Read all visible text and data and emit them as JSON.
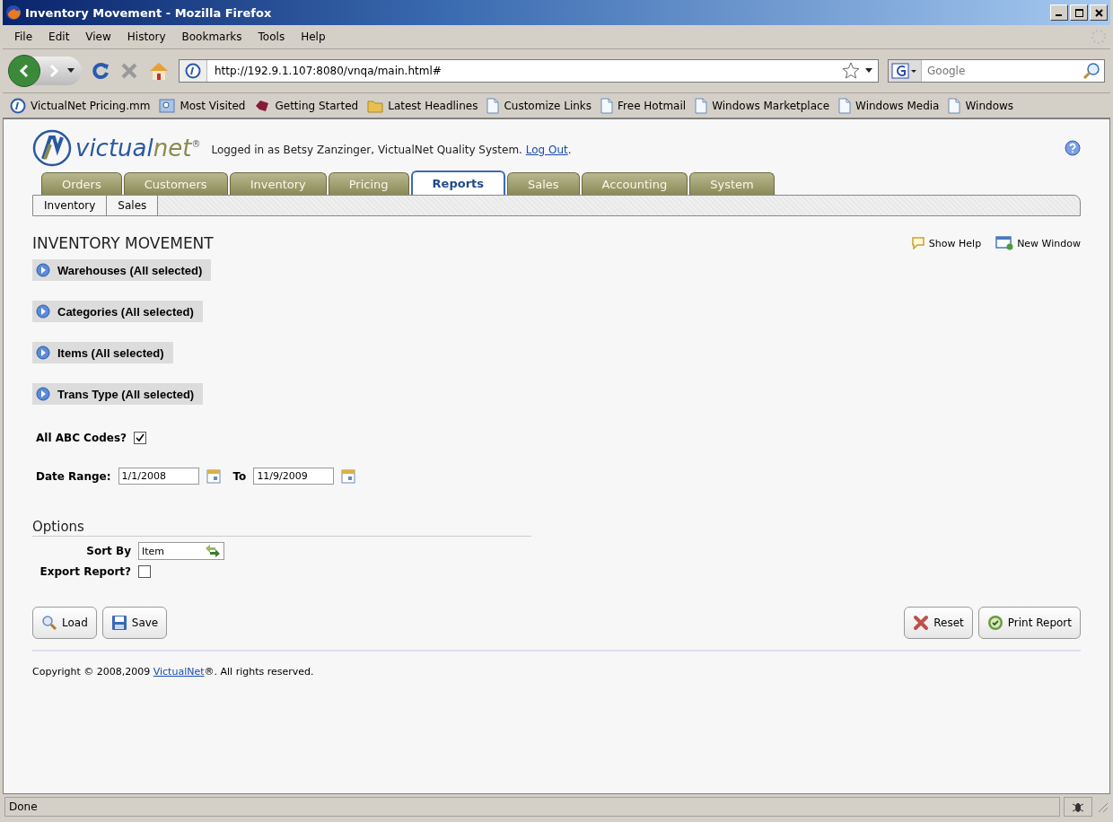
{
  "window": {
    "title": "Inventory Movement - Mozilla Firefox"
  },
  "menu": [
    "File",
    "Edit",
    "View",
    "History",
    "Bookmarks",
    "Tools",
    "Help"
  ],
  "address": {
    "value": "http://192.9.1.107:8080/vnqa/main.html#"
  },
  "search": {
    "placeholder": "Google"
  },
  "bookmarks": [
    {
      "label": "VictualNet Pricing.mm",
      "kind": "site"
    },
    {
      "label": "Most Visited",
      "kind": "folder"
    },
    {
      "label": "Getting Started",
      "kind": "firefox"
    },
    {
      "label": "Latest Headlines",
      "kind": "feed"
    },
    {
      "label": "Customize Links",
      "kind": "page"
    },
    {
      "label": "Free Hotmail",
      "kind": "page"
    },
    {
      "label": "Windows Marketplace",
      "kind": "page"
    },
    {
      "label": "Windows Media",
      "kind": "page"
    },
    {
      "label": "Windows",
      "kind": "page"
    }
  ],
  "header": {
    "logo_first": "victual",
    "logo_second": "net",
    "logo_mark": "®",
    "login_text": "Logged in as Betsy Zanzinger, VictualNet Quality System. ",
    "logout_link": "Log Out",
    "login_end": "."
  },
  "tabs": [
    {
      "label": "Orders",
      "selected": false
    },
    {
      "label": "Customers",
      "selected": false
    },
    {
      "label": "Inventory",
      "selected": false
    },
    {
      "label": "Pricing",
      "selected": false
    },
    {
      "label": "Reports",
      "selected": true
    },
    {
      "label": "Sales",
      "selected": false
    },
    {
      "label": "Accounting",
      "selected": false
    },
    {
      "label": "System",
      "selected": false
    }
  ],
  "subtabs": [
    "Inventory",
    "Sales"
  ],
  "page_title": "INVENTORY MOVEMENT",
  "page_links": [
    {
      "label": "Show Help",
      "kind": "help"
    },
    {
      "label": "New Window",
      "kind": "window"
    }
  ],
  "filters": [
    "Warehouses (All selected)",
    "Categories (All selected)",
    "Items (All selected)",
    "Trans Type (All selected)"
  ],
  "abc": {
    "label": "All ABC Codes?",
    "checked": true
  },
  "date_range": {
    "label": "Date Range:",
    "from": "1/1/2008",
    "to_label": "To",
    "to": "11/9/2009"
  },
  "options": {
    "title": "Options",
    "sort_label": "Sort By",
    "sort_value": "Item",
    "export_label": "Export Report?",
    "export_checked": false
  },
  "left_buttons": [
    {
      "label": "Load",
      "kind": "load"
    },
    {
      "label": "Save",
      "kind": "save"
    }
  ],
  "right_buttons": [
    {
      "label": "Reset",
      "kind": "reset"
    },
    {
      "label": "Print Report",
      "kind": "print"
    }
  ],
  "footer": {
    "text": "Copyright © 2008,2009 ",
    "link": "VictualNet",
    "end": "®. All rights reserved."
  },
  "status_bar": {
    "text": "Done"
  }
}
